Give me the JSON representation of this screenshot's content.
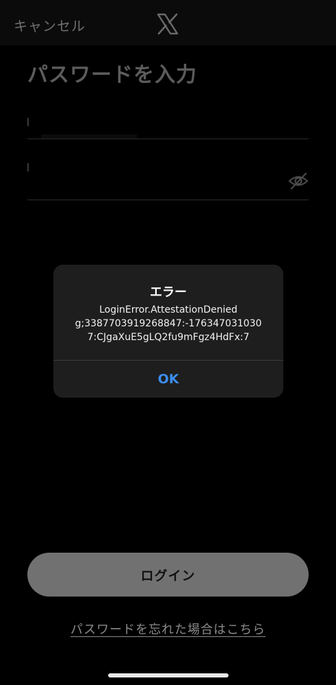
{
  "header": {
    "cancel_label": "キャンセル",
    "logo_icon": "x-logo-icon"
  },
  "main": {
    "title": "パスワードを入力",
    "password_toggle_icon": "eye-slash-icon"
  },
  "footer": {
    "login_label": "ログイン",
    "forgot_label": "パスワードを忘れた場合はこちら"
  },
  "alert": {
    "title": "エラー",
    "message_lines": [
      "LoginError.AttestationDenied",
      "g;3387703919268847:-176347031030",
      "7:CJgaXuE5gLQ2fu9mFgz4HdFx:7"
    ],
    "ok_label": "OK"
  },
  "colors": {
    "background": "#000000",
    "alert_background": "#1e1e1e",
    "ok_accent": "#3b8ef0",
    "login_button": "#717171"
  }
}
